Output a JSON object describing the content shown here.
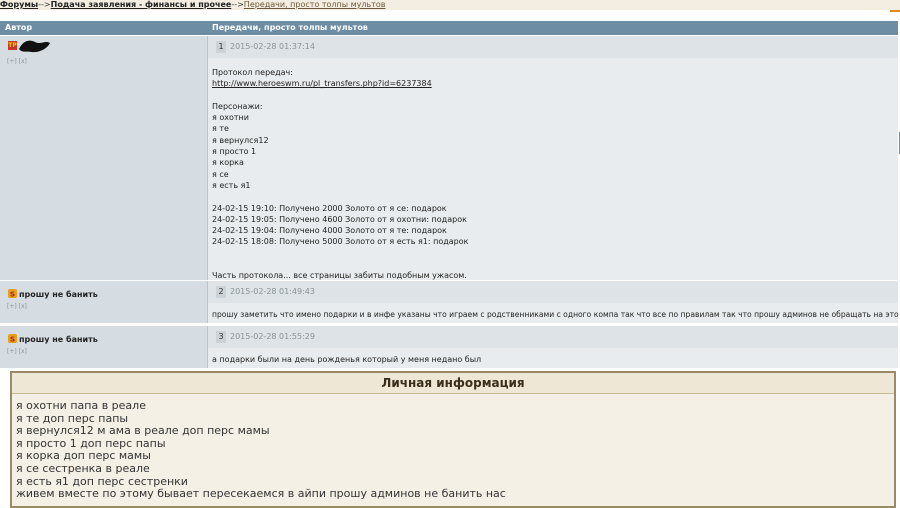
{
  "breadcrumb": {
    "forums": "Форумы",
    "sep1": "-->",
    "section": "Подача заявления - финансы и прочее",
    "sep2": "-->",
    "topic": "Передачи, просто толпы мультов"
  },
  "table": {
    "col_author": "Автор",
    "col_topic": "Передачи, просто толпы мультов"
  },
  "posts": [
    {
      "author_tag": "TP",
      "author_links": "[+] [x]",
      "num": "1",
      "date": "2015-02-28 01:37:14",
      "link": "http://www.heroeswm.ru/pl_transfers.php?id=6237384",
      "line_intro": "Протокол передач:",
      "chars_label": "Персонажи:",
      "chars": [
        "я охотни",
        "я те",
        "я вернулся12",
        "я просто 1",
        "я корка",
        "я се",
        "я есть я1"
      ],
      "log": [
        "24-02-15 19:10: Получено 2000 Золото от я се: подарок",
        "24-02-15 19:05: Получено 4600 Золото от я охотни: подарок",
        "24-02-15 19:04: Получено 4000 Золото от я те: подарок",
        "24-02-15 18:08: Получено 5000 Золото от я есть я1: подарок"
      ],
      "footer": "Часть протокола... все страницы забиты подобным ужасом."
    },
    {
      "author": "прошу не банить",
      "author_links": "[+] [x]",
      "num": "2",
      "date": "2015-02-28 01:49:43",
      "text": "прошу заметить что имено подарки и в инфе указаны что играем с родственниками с одного компа так что все по правилам так что прошу админов не обращать на это внимания"
    },
    {
      "author": "прошу не банить",
      "author_links": "[+] [x]",
      "num": "3",
      "date": "2015-02-28 01:55:29",
      "text": "а подарки были на день рожденья который у меня недано был"
    }
  ],
  "info": {
    "title": "Личная информация",
    "lines": [
      "я охотни папа в реале",
      "я те доп перс папы",
      "я вернулся12 м ама в реале доп перс мамы",
      "я просто 1 доп перс папы",
      "я корка доп перс мамы",
      "я се сестренка в реале",
      "я есть я1 доп перс сестренки",
      "живем вместе по этому бывает пересекаемся в айпи прошу админов не банить нас"
    ]
  },
  "colors": {
    "header_bg": "#6c8da4",
    "author_bg": "#d5dde2",
    "post_bg": "#e9ecee",
    "info_border": "#9a8a66"
  }
}
